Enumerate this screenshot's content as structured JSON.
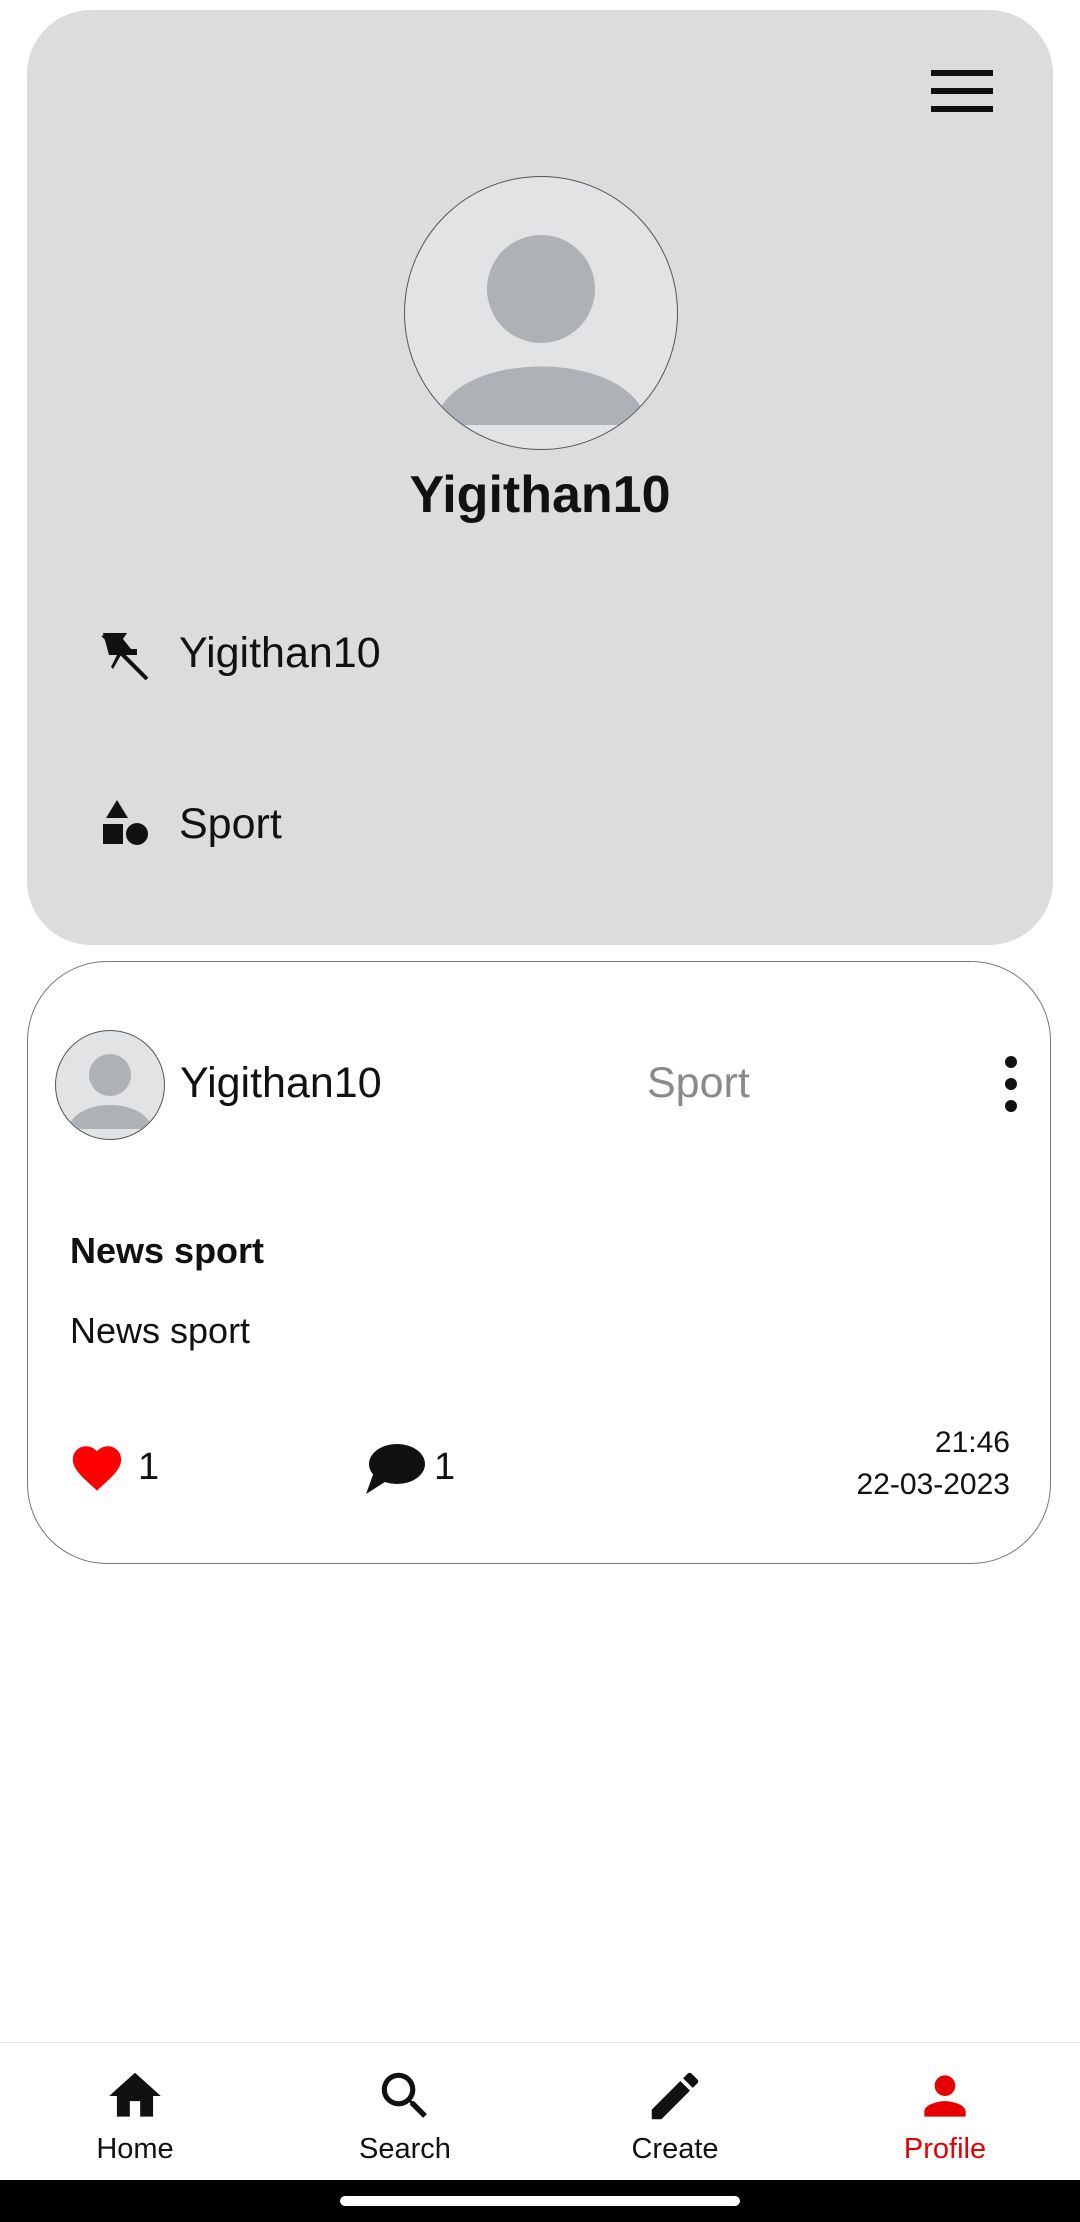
{
  "profile": {
    "username": "Yigithan10",
    "pinned_label": "Yigithan10",
    "category_label": "Sport"
  },
  "post": {
    "username": "Yigithan10",
    "category": "Sport",
    "title": "News sport",
    "body": "News sport",
    "likes": "1",
    "comments": "1",
    "time": "21:46",
    "date": "22-03-2023"
  },
  "nav": {
    "items": [
      {
        "label": "Home",
        "icon": "home-icon"
      },
      {
        "label": "Search",
        "icon": "search-icon"
      },
      {
        "label": "Create",
        "icon": "pencil-icon"
      },
      {
        "label": "Profile",
        "icon": "person-icon"
      }
    ],
    "active": "Profile"
  },
  "colors": {
    "accent": "#e60000",
    "like": "#ff0000",
    "card_bg": "#dcdcdd",
    "muted_text": "#8a8a8a"
  }
}
